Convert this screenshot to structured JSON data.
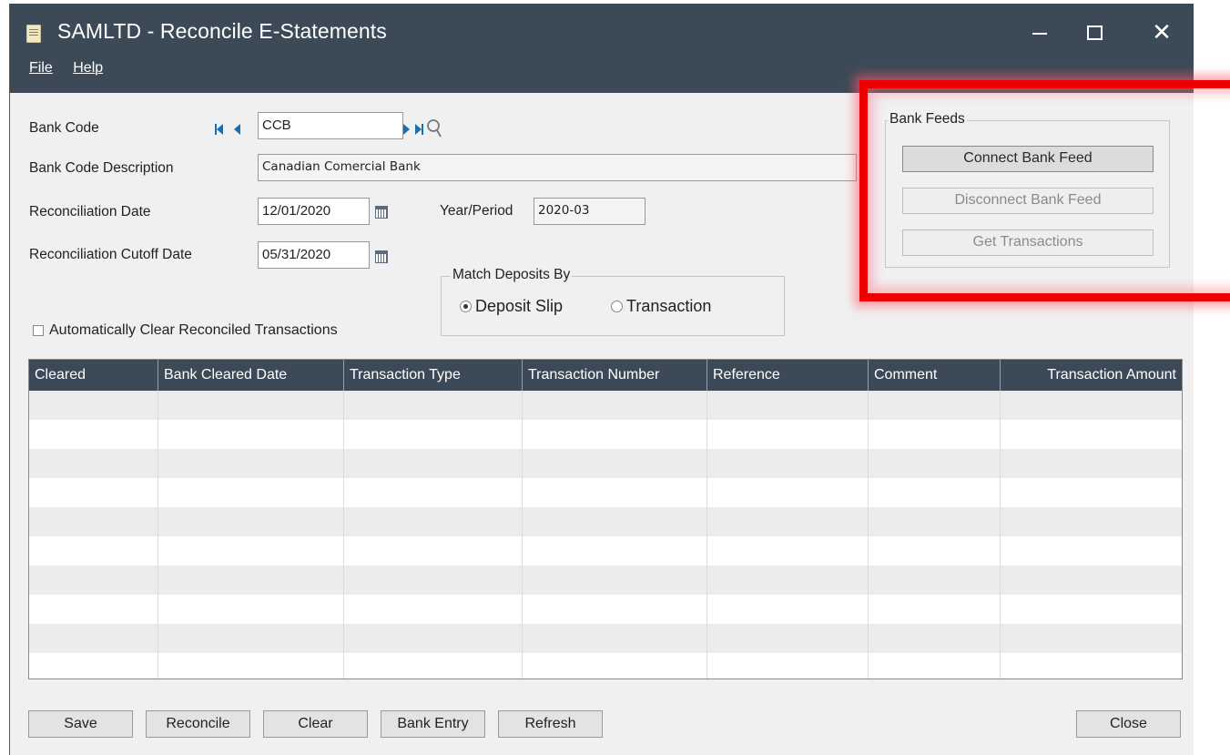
{
  "window": {
    "title": "SAMLTD - Reconcile E-Statements",
    "menu": [
      "File",
      "Help"
    ]
  },
  "form": {
    "bank_code_label": "Bank Code",
    "bank_code_value": "CCB",
    "bank_code_desc_label": "Bank Code Description",
    "bank_code_desc_value": "Canadian Comercial Bank",
    "recon_date_label": "Reconciliation Date",
    "recon_date_value": "12/01/2020",
    "year_period_label": "Year/Period",
    "year_period_value": "2020-03",
    "cutoff_label": "Reconciliation Cutoff Date",
    "cutoff_value": "05/31/2020",
    "match_group_label": "Match Deposits By",
    "match_options": [
      "Deposit Slip",
      "Transaction"
    ],
    "match_selected": "Deposit Slip",
    "auto_clear_label": "Automatically Clear Reconciled Transactions",
    "auto_clear_checked": false
  },
  "bank_feeds": {
    "group_label": "Bank Feeds",
    "connect_label": "Connect Bank Feed",
    "disconnect_label": "Disconnect Bank Feed",
    "get_transactions_label": "Get Transactions",
    "highlight_color": "#ee0000"
  },
  "grid": {
    "columns": [
      "Cleared",
      "Bank Cleared Date",
      "Transaction Type",
      "Transaction Number",
      "Reference",
      "Comment",
      "Transaction  Amount"
    ],
    "rows": []
  },
  "footer": {
    "save_label": "Save",
    "reconcile_label": "Reconcile",
    "clear_label": "Clear",
    "bank_entry_label": "Bank Entry",
    "refresh_label": "Refresh",
    "close_label": "Close"
  },
  "colors": {
    "titlebar": "#3c4a57",
    "grid_header": "#3c4a57",
    "nav_arrows": "#1a6fb0"
  }
}
